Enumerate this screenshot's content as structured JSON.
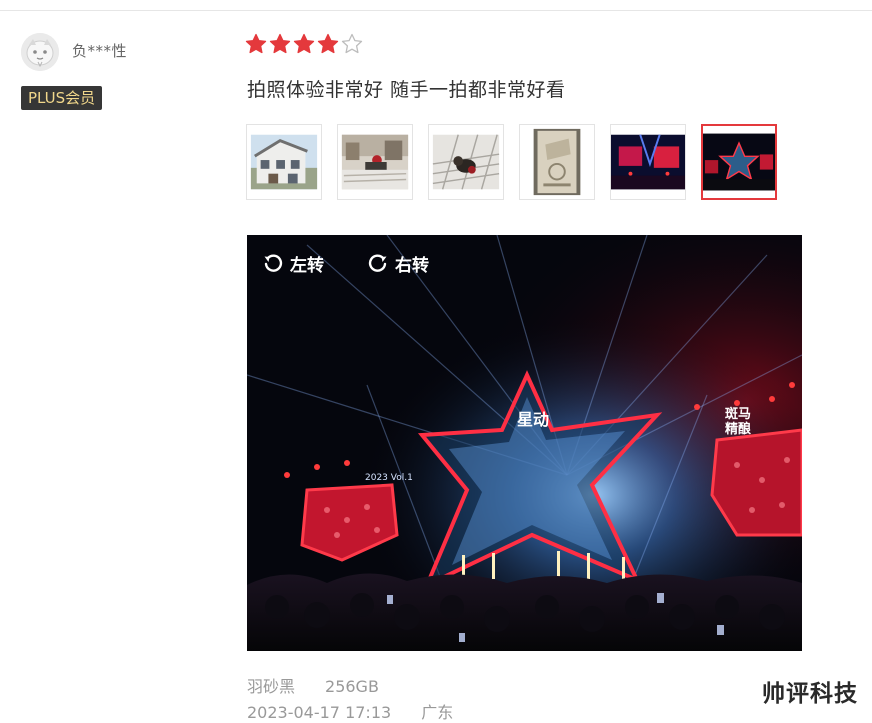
{
  "user": {
    "name": "负***性",
    "badge": "PLUS会员",
    "avatar_icon": "default-avatar-icon"
  },
  "review": {
    "rating": 4,
    "max_rating": 5,
    "star_color": "#e4393c",
    "text": "拍照体验非常好 随手一拍都非常好看",
    "thumbnails": [
      {
        "icon": "house-photo"
      },
      {
        "icon": "street-scene-photo"
      },
      {
        "icon": "cat-photo"
      },
      {
        "icon": "product-box-photo"
      },
      {
        "icon": "concert-screen-photo"
      },
      {
        "icon": "concert-stage-photo",
        "selected": true
      }
    ],
    "selected_index": 5,
    "selection_color": "#e4393c"
  },
  "viewer": {
    "rotate_left_label": "左转",
    "rotate_right_label": "右转",
    "stage_sign": "星动",
    "screen_sign_line1": "斑马",
    "screen_sign_line2": "精酿",
    "banner_text": "2023 Vol.1"
  },
  "meta": {
    "color": "羽砂黑",
    "storage": "256GB",
    "datetime": "2023-04-17 17:13",
    "location": "广东"
  },
  "watermark": "帅评科技"
}
